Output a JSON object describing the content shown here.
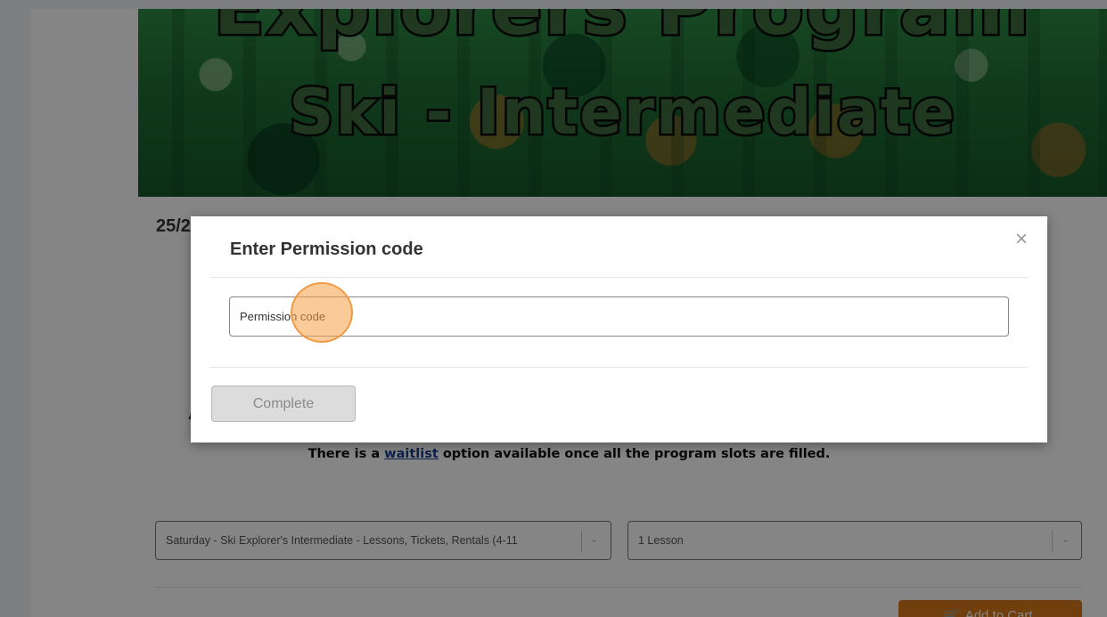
{
  "banner": {
    "title": "Explorers Program",
    "subtitle": "Ski - Intermediate"
  },
  "page": {
    "heading": "25/2",
    "hidden_letter": "A",
    "waitlist_prefix": "There is a ",
    "waitlist_link": "waitlist",
    "waitlist_suffix": " option available once all the program slots are filled."
  },
  "selects": {
    "program_value": "Saturday - Ski Explorer's Intermediate - Lessons, Tickets, Rentals (4-11",
    "lessons_value": "1 Lesson"
  },
  "cart": {
    "icon": "cart-icon",
    "label": "Add to Cart"
  },
  "modal": {
    "title": "Enter Permission code",
    "close_icon": "close-icon",
    "close_symbol": "×",
    "input_placeholder": "Permission code",
    "input_value": "",
    "complete_label": "Complete"
  },
  "colors": {
    "overlay": "#000000",
    "cart_button": "#d9781a",
    "link": "#1a3f8f",
    "cursor_highlight": "#f5a046"
  }
}
